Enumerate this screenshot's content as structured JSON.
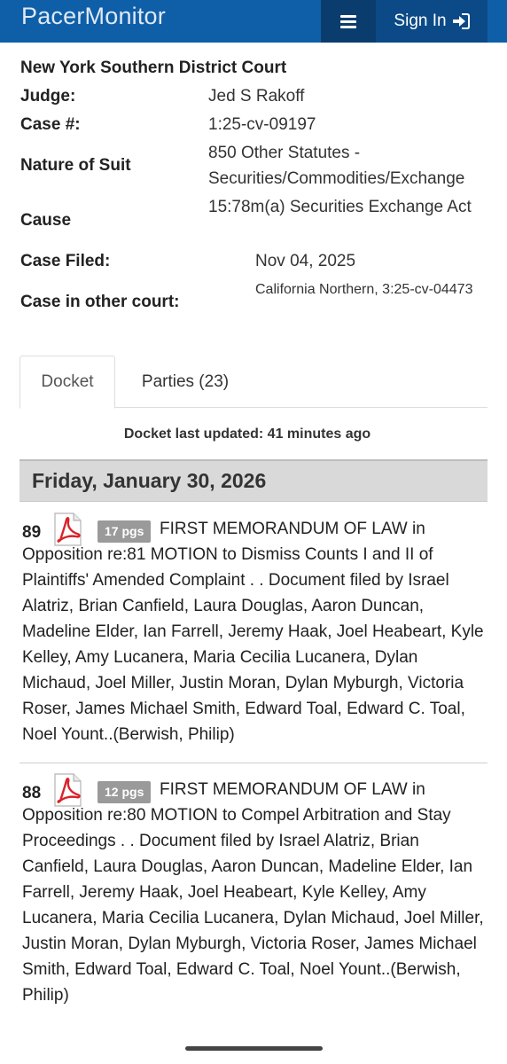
{
  "header": {
    "brand": "PacerMonitor",
    "signin_label": "Sign In"
  },
  "case": {
    "court": "New York Southern District Court",
    "judge_label": "Judge:",
    "judge": "Jed S Rakoff",
    "case_no_label": "Case #:",
    "case_no": "1:25-cv-09197",
    "nature_label": "Nature of Suit",
    "nature": "850 Other Statutes - Securities/Commodities/Exchange",
    "cause_label": "Cause",
    "cause": "15:78m(a) Securities Exchange Act",
    "filed_label": "Case Filed:",
    "filed": "Nov 04, 2025",
    "other_court_label": "Case in other court:",
    "other_court": "California Northern, 3:25-cv-04473"
  },
  "tabs": [
    {
      "label": "Docket",
      "active": true
    },
    {
      "label": "Parties (23)",
      "active": false
    }
  ],
  "docket_updated": "Docket last updated: 41 minutes ago",
  "date_heading": "Friday, January 30, 2026",
  "entries": [
    {
      "number": "89",
      "pages": "17 pgs",
      "text": "FIRST MEMORANDUM OF LAW in Opposition re:81 MOTION to Dismiss Counts I and II of Plaintiffs' Amended Complaint . . Document filed by Israel Alatriz, Brian Canfield, Laura Douglas, Aaron Duncan, Madeline Elder, Ian Farrell, Jeremy Haak, Joel Heabeart, Kyle Kelley, Amy Lucanera, Maria Cecilia Lucanera, Dylan Michaud, Joel Miller, Justin Moran, Dylan Myburgh, Victoria Roser, James Michael Smith, Edward Toal, Edward C. Toal, Noel Yount..(Berwish, Philip)"
    },
    {
      "number": "88",
      "pages": "12 pgs",
      "text": "FIRST MEMORANDUM OF LAW in Opposition re:80 MOTION to Compel Arbitration and Stay Proceedings . . Document filed by Israel Alatriz, Brian Canfield, Laura Douglas, Aaron Duncan, Madeline Elder, Ian Farrell, Jeremy Haak, Joel Heabeart, Kyle Kelley, Amy Lucanera, Maria Cecilia Lucanera, Dylan Michaud, Joel Miller, Justin Moran, Dylan Myburgh, Victoria Roser, James Michael Smith, Edward Toal, Edward C. Toal, Noel Yount..(Berwish, Philip)"
    }
  ],
  "colors": {
    "header_bg": "#0f5fa8",
    "menu_bg": "#0a3d6e",
    "signin_bg": "#0b4a87",
    "date_bar": "#d9d9d9",
    "pdf_red": "#d8232a"
  },
  "icons": {
    "menu": "hamburger-icon",
    "signin": "sign-in-icon",
    "document": "pdf-file-icon"
  }
}
